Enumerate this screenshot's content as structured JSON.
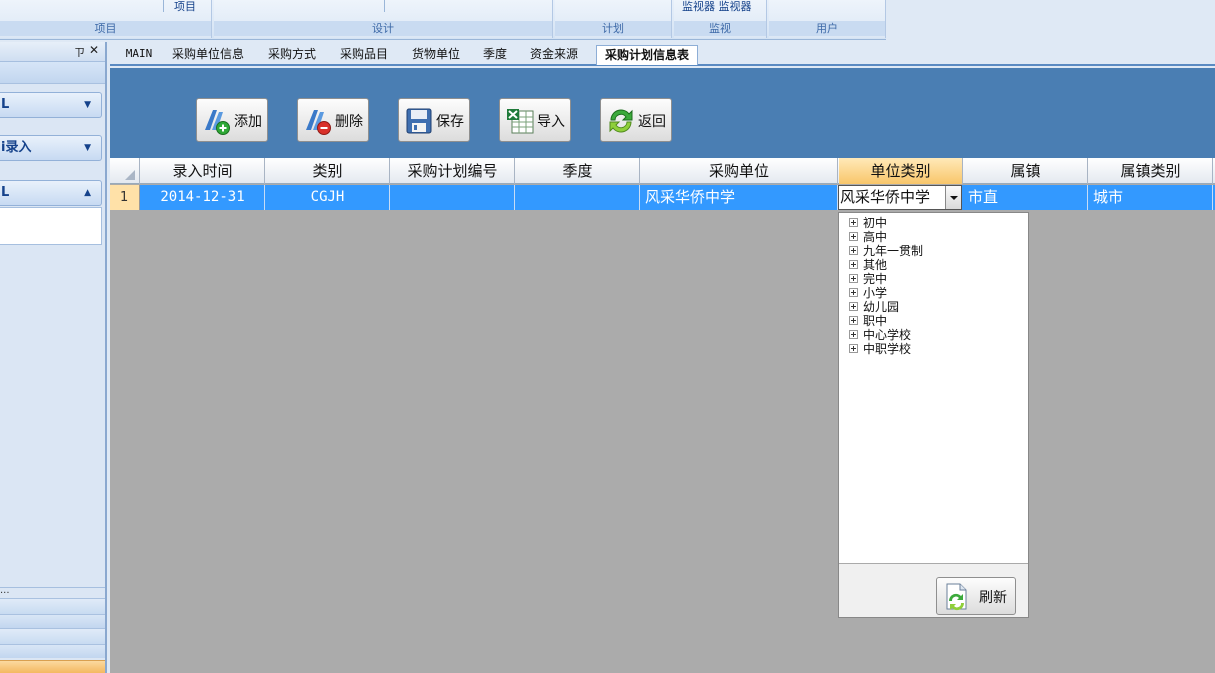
{
  "ribbon": {
    "groups": [
      {
        "caption": "项目",
        "text": "项目"
      },
      {
        "caption": "设计"
      },
      {
        "caption": "计划"
      },
      {
        "caption": "监视",
        "text": "监视器 监视器"
      },
      {
        "caption": "用户"
      }
    ]
  },
  "left_panel": {
    "pin": "ㄗ",
    "close": "✕",
    "items": [
      {
        "label": "L"
      },
      {
        "label": "i录入"
      },
      {
        "label": "L"
      }
    ],
    "footer_dots": "..."
  },
  "tabs": [
    {
      "label": "MAIN"
    },
    {
      "label": "采购单位信息"
    },
    {
      "label": "采购方式"
    },
    {
      "label": "采购品目"
    },
    {
      "label": "货物单位"
    },
    {
      "label": "季度"
    },
    {
      "label": "资金来源"
    },
    {
      "label": "采购计划信息表",
      "active": true
    }
  ],
  "toolbar": {
    "add_label": "添加",
    "delete_label": "删除",
    "save_label": "保存",
    "import_label": "导入",
    "back_label": "返回"
  },
  "grid": {
    "columns": [
      "录入时间",
      "类别",
      "采购计划编号",
      "季度",
      "采购单位",
      "单位类别",
      "属镇",
      "属镇类别"
    ],
    "rows": [
      {
        "index": "1",
        "entry_time": "2014-12-31",
        "category": "CGJH",
        "plan_no": "",
        "quarter": "",
        "unit": "风采华侨中学",
        "unit_type": "风采华侨中学",
        "town": "市直",
        "town_type": "城市"
      }
    ]
  },
  "dropdown": {
    "options": [
      "初中",
      "高中",
      "九年一贯制",
      "其他",
      "完中",
      "小学",
      "幼儿园",
      "职中",
      "中心学校",
      "中职学校"
    ],
    "refresh_label": "刷新"
  },
  "colors": {
    "toolbar_bg": "#4a7eb3",
    "selected_row": "#3399ff",
    "highlight_header": "#f8c66a"
  }
}
